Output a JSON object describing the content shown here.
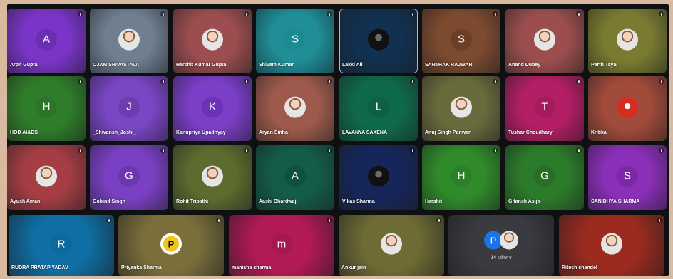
{
  "rows": [
    [
      {
        "name": "Arpit Gupta",
        "initial": "A",
        "bg": "#7a35c7",
        "avatar": "#6a2fb0",
        "type": "letter"
      },
      {
        "name": "OJAM SRIVASTAVA",
        "initial": "",
        "bg": "#6f7f91",
        "avatar": "#d8d8d8",
        "type": "photo"
      },
      {
        "name": "Harshit Kumar Gupta",
        "initial": "",
        "bg": "#9b4d4f",
        "avatar": "#d0c0b0",
        "type": "photo"
      },
      {
        "name": "Shivam Kumar",
        "initial": "S",
        "bg": "#1f8e97",
        "avatar": "#1a8a93",
        "type": "letter"
      },
      {
        "name": "Lakki Ali",
        "initial": "",
        "bg": "#12304f",
        "avatar": "#111",
        "type": "photo-dark"
      },
      {
        "name": "SARTHAK RAJWAR",
        "initial": "S",
        "bg": "#7b4a2f",
        "avatar": "#6c3e26",
        "type": "letter"
      },
      {
        "name": "Anand Dubey",
        "initial": "",
        "bg": "#9c4e4e",
        "avatar": "#caa88b",
        "type": "photo"
      },
      {
        "name": "Parth Tayal",
        "initial": "",
        "bg": "#7a7b30",
        "avatar": "#d0c58a",
        "type": "photo"
      }
    ],
    [
      {
        "name": "HOD AI&DS",
        "initial": "H",
        "bg": "#2f7d2a",
        "avatar": "#2c7527",
        "type": "letter"
      },
      {
        "name": "_Shivansh_Joshi_",
        "initial": "J",
        "bg": "#7a46c4",
        "avatar": "#6c3cb0",
        "type": "letter"
      },
      {
        "name": "Kanupriya Upadhyay",
        "initial": "K",
        "bg": "#7a3ec7",
        "avatar": "#6a32b4",
        "type": "letter"
      },
      {
        "name": "Aryan Sinha",
        "initial": "",
        "bg": "#9d5a4c",
        "avatar": "#f3c46b",
        "type": "photo"
      },
      {
        "name": "LAVANYA SAXENA",
        "initial": "L",
        "bg": "#0f6a4b",
        "avatar": "#0e5f43",
        "type": "letter"
      },
      {
        "name": "Anuj Singh Panwar",
        "initial": "",
        "bg": "#6a6b3c",
        "avatar": "#c8b59e",
        "type": "photo"
      },
      {
        "name": "Tushar Choudhary",
        "initial": "T",
        "bg": "#b31e64",
        "avatar": "#a51b5c",
        "type": "letter"
      },
      {
        "name": "Kritika",
        "initial": "",
        "bg": "#a14b3b",
        "avatar": "#d42e21",
        "type": "photo-flower"
      }
    ],
    [
      {
        "name": "Ayush Aman",
        "initial": "",
        "bg": "#a43d44",
        "avatar": "#e6e6e6",
        "type": "photo"
      },
      {
        "name": "Gobind Singh",
        "initial": "G",
        "bg": "#7a40c3",
        "avatar": "#6c36b0",
        "type": "letter"
      },
      {
        "name": "Rohit Tripathi",
        "initial": "",
        "bg": "#5d6b2e",
        "avatar": "#d9d2a9",
        "type": "photo"
      },
      {
        "name": "Aashi Bhardwaj",
        "initial": "A",
        "bg": "#135c48",
        "avatar": "#0f5140",
        "type": "letter"
      },
      {
        "name": "Vikas Sharma",
        "initial": "",
        "bg": "#16265a",
        "avatar": "#111",
        "type": "photo-dark"
      },
      {
        "name": "Harshit",
        "initial": "H",
        "bg": "#2f8a2a",
        "avatar": "#2b7f27",
        "type": "letter"
      },
      {
        "name": "Gitansh Asija",
        "initial": "G",
        "bg": "#2c7b2a",
        "avatar": "#286f26",
        "type": "letter"
      },
      {
        "name": "SANIDHYA SHARMA",
        "initial": "S",
        "bg": "#8a2fb7",
        "avatar": "#7b28a6",
        "type": "letter"
      }
    ]
  ],
  "bottom": [
    {
      "name": "RUDRA PRATAP YADAV",
      "initial": "R",
      "bg": "#0f6ea3",
      "avatar": "#0d6aa0",
      "type": "letter"
    },
    {
      "name": "Priyanka Sharma",
      "initial": "P",
      "bg": "#7a6f3b",
      "avatar": "#fff",
      "type": "photo-pbadge"
    },
    {
      "name": "manisha sharma",
      "initial": "m",
      "bg": "#b21a56",
      "avatar": "#a4194f",
      "type": "letter"
    },
    {
      "name": "Ankur jain",
      "initial": "",
      "bg": "#6e6b34",
      "avatar": "#d8d8d8",
      "type": "photo"
    },
    {
      "name": "",
      "initial": "",
      "bg": "#3a3b40",
      "avatar": "",
      "type": "others",
      "others_label": "14 others",
      "others_initial": "P"
    },
    {
      "name": "Ritesh chandel",
      "initial": "",
      "bg": "#9b2b1f",
      "avatar": "#f2f2f2",
      "type": "photo"
    }
  ]
}
